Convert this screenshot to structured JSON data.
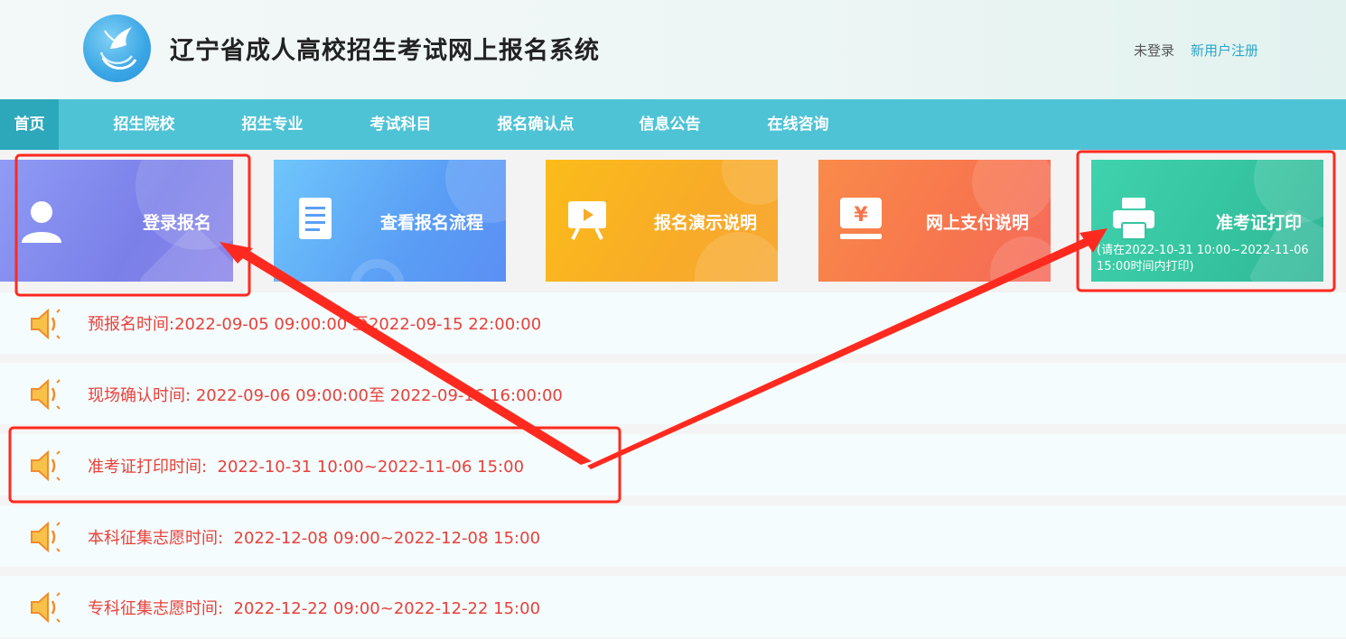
{
  "header": {
    "title": "辽宁省成人高校招生考试网上报名系统",
    "login_state": "未登录",
    "register_link": "新用户注册"
  },
  "nav": {
    "items": [
      {
        "label": "首页",
        "active": true
      },
      {
        "label": "招生院校"
      },
      {
        "label": "招生专业"
      },
      {
        "label": "考试科目"
      },
      {
        "label": "报名确认点"
      },
      {
        "label": "信息公告"
      },
      {
        "label": "在线咨询"
      }
    ]
  },
  "tiles": [
    {
      "label": "登录报名",
      "icon": "user-icon",
      "color": "#7d87ee"
    },
    {
      "label": "查看报名流程",
      "icon": "document-icon",
      "color": "#5aa5f6"
    },
    {
      "label": "报名演示说明",
      "icon": "play-board-icon",
      "color": "#f7ad24"
    },
    {
      "label": "网上支付说明",
      "icon": "payment-yuan-icon",
      "color": "#f77b55"
    },
    {
      "label": "准考证打印",
      "sub": "(请在2022-10-31 10:00~2022-11-06 15:00时间内打印)",
      "icon": "printer-icon",
      "color": "#35c7a0"
    }
  ],
  "notices": [
    {
      "label": "预报名时间:",
      "value": "2022-09-05 09:00:00 至2022-09-15 22:00:00"
    },
    {
      "label": "现场确认时间:",
      "value": "2022-09-06 09:00:00至 2022-09-16 16:00:00"
    },
    {
      "label": "准考证打印时间:",
      "value": "2022-10-31 10:00~2022-11-06 15:00"
    },
    {
      "label": "本科征集志愿时间:",
      "value": "2022-12-08 09:00~2022-12-08 15:00"
    },
    {
      "label": "专科征集志愿时间:",
      "value": "2022-12-22 09:00~2022-12-22 15:00"
    }
  ],
  "annotation": {
    "color": "#ff2a1f"
  }
}
